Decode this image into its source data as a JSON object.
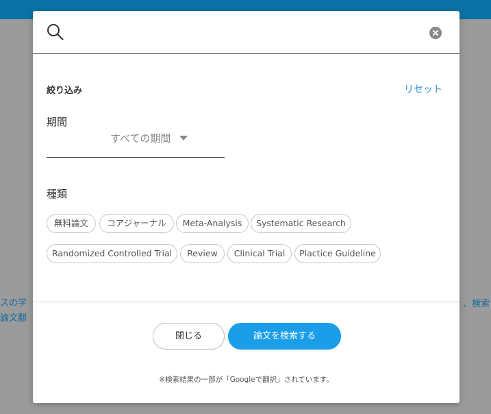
{
  "background": {
    "left_text": "スの学\n論文翻",
    "right_text": "、検索"
  },
  "modal": {
    "search": {
      "placeholder": "",
      "value": "",
      "search_icon": "search-icon",
      "clear_icon": "close-circle-icon"
    },
    "filter": {
      "title": "絞り込み",
      "reset": "リセット"
    },
    "period": {
      "label": "期間",
      "selected": "すべての期間"
    },
    "type": {
      "label": "種類",
      "chips": [
        "無料論文",
        "コアジャーナル",
        "Meta-Analysis",
        "Systematic Research",
        "Randomized Controlled Trial",
        "Review",
        "Clinical Trial",
        "Plactice Guideline"
      ]
    },
    "buttons": {
      "close": "閉じる",
      "search": "論文を検索する"
    },
    "note": "※検索結果の一部が「Googleで翻訳」されています。"
  },
  "colors": {
    "accent": "#1a9ee8",
    "link": "#2e8fd6",
    "topbar": "#0a72a6",
    "overlay": "#9b9b9b"
  }
}
